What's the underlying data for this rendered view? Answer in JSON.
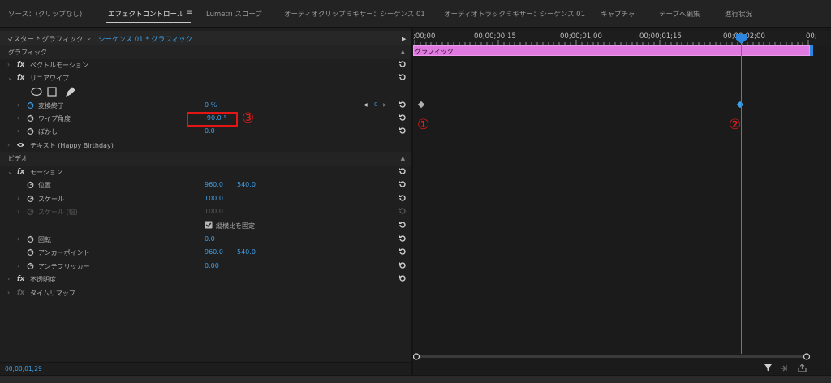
{
  "tabs": [
    "ソース：(クリップなし)",
    "エフェクトコントロール",
    "Lumetri スコープ",
    "オーディオクリップミキサー：シーケンス 01",
    "オーディオトラックミキサー：シーケンス 01",
    "キャプチャ",
    "テープへ編集",
    "進行状況"
  ],
  "header": {
    "master": "マスター * グラフィック",
    "sequence": "シーケンス 01 * グラフィック"
  },
  "sections": {
    "graphic": "グラフィック",
    "video": "ビデオ"
  },
  "effects": {
    "vector_motion": "ベクトルモーション",
    "linear_wipe": "リニアワイプ",
    "transition_completion": {
      "label": "変換終了",
      "value": "0 %"
    },
    "wipe_angle": {
      "label": "ワイプ角度",
      "value": "-90.0 °"
    },
    "feather": {
      "label": "ぼかし",
      "value": "0.0"
    },
    "text": "テキスト (Happy Birthday)",
    "motion": "モーション",
    "position": {
      "label": "位置",
      "x": "960.0",
      "y": "540.0"
    },
    "scale": {
      "label": "スケール",
      "value": "100.0"
    },
    "scale_width": {
      "label": "スケール (幅)",
      "value": "100.0"
    },
    "uniform_scale": "縦横比を固定",
    "rotation": {
      "label": "回転",
      "value": "0.0"
    },
    "anchor_point": {
      "label": "アンカーポイント",
      "x": "960.0",
      "y": "540.0"
    },
    "anti_flicker": {
      "label": "アンチフリッカー",
      "value": "0.00"
    },
    "opacity": "不透明度",
    "time_remap": "タイムリマップ"
  },
  "fx_label": "fx",
  "kf_index": "0",
  "timeline": {
    "timecodes": [
      ";00;00",
      "00;00;00;15",
      "00;00;01;00",
      "00;00;01;15",
      "00;00;02;00",
      "00;"
    ],
    "clip_label": "グラフィック",
    "current_time": "00;00;01;29"
  },
  "annotations": {
    "one": "①",
    "two": "②",
    "three": "③"
  },
  "colors": {
    "accent": "#3f9fe6",
    "clip": "#e07ae0",
    "playhead": "#2c86e0",
    "highlight": "#e31515"
  }
}
